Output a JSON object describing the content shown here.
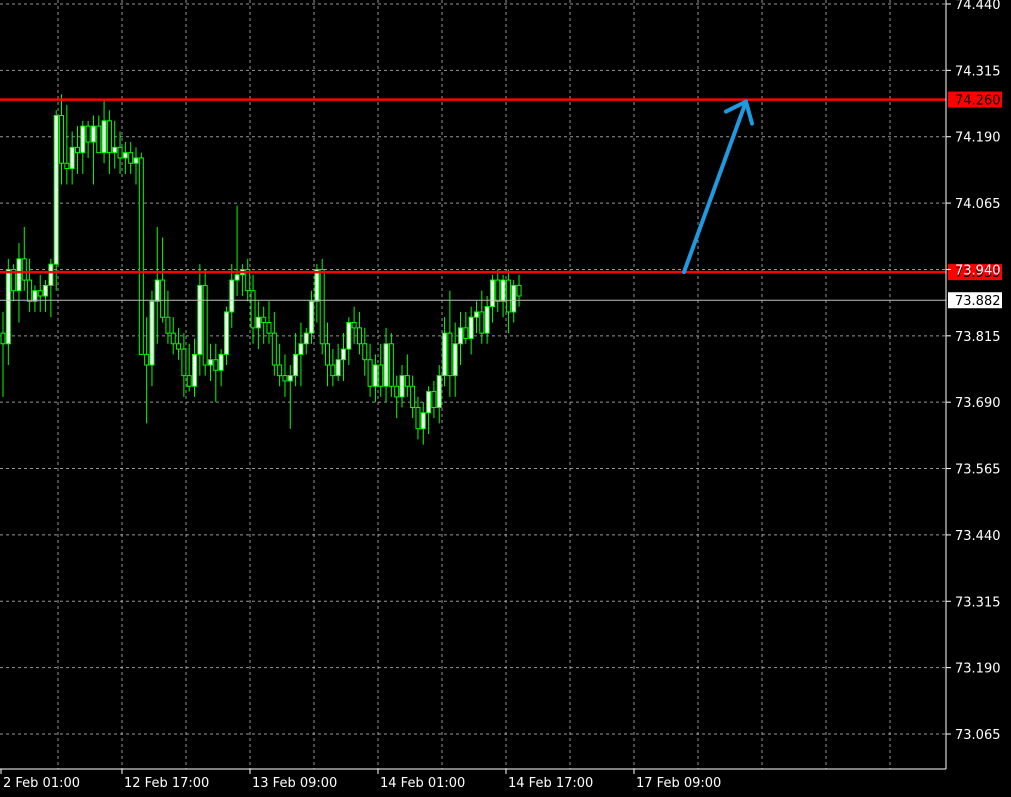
{
  "colors": {
    "background": "#000000",
    "grid": "#c8c8c8",
    "axis": "#ffffff",
    "candle_up_body": "#ffffff",
    "candle_down_body": "#000000",
    "candle_outline": "#00ff00",
    "level_line": "#ff0000",
    "current_price_line": "#c0c0c0",
    "arrow": "#1e9be0"
  },
  "chart_data": {
    "type": "candlestick",
    "ylim": [
      73.0,
      74.44
    ],
    "y_ticks": [
      "74.440",
      "74.315",
      "74.190",
      "74.065",
      "73.940",
      "73.815",
      "73.690",
      "73.565",
      "73.440",
      "73.315",
      "73.190",
      "73.065"
    ],
    "x_ticks": [
      "2 Feb 01:00",
      "12 Feb 17:00",
      "13 Feb 09:00",
      "14 Feb 01:00",
      "14 Feb 17:00",
      "17 Feb 09:00"
    ],
    "grid": true,
    "levels": [
      {
        "value": 74.26,
        "label": "74.260"
      },
      {
        "value": 73.935,
        "label": "73.935"
      }
    ],
    "current_price": {
      "value": 73.882,
      "label": "73.882"
    },
    "candles": [
      [
        73.82,
        73.86,
        73.7,
        73.8
      ],
      [
        73.8,
        73.96,
        73.76,
        73.94
      ],
      [
        73.94,
        73.95,
        73.88,
        73.9
      ],
      [
        73.9,
        73.99,
        73.84,
        73.96
      ],
      [
        73.96,
        74.02,
        73.9,
        73.92
      ],
      [
        73.92,
        73.96,
        73.86,
        73.88
      ],
      [
        73.88,
        73.91,
        73.86,
        73.9
      ],
      [
        73.9,
        73.93,
        73.86,
        73.89
      ],
      [
        73.89,
        73.92,
        73.86,
        73.91
      ],
      [
        73.91,
        73.96,
        73.85,
        73.95
      ],
      [
        73.95,
        74.24,
        73.9,
        74.23
      ],
      [
        74.23,
        74.27,
        74.1,
        74.14
      ],
      [
        74.14,
        74.25,
        74.1,
        74.13
      ],
      [
        74.13,
        74.2,
        74.1,
        74.17
      ],
      [
        74.17,
        74.21,
        74.12,
        74.16
      ],
      [
        74.16,
        74.22,
        74.12,
        74.21
      ],
      [
        74.21,
        74.22,
        74.15,
        74.18
      ],
      [
        74.18,
        74.23,
        74.1,
        74.21
      ],
      [
        74.21,
        74.23,
        74.17,
        74.16
      ],
      [
        74.16,
        74.26,
        74.14,
        74.22
      ],
      [
        74.22,
        74.24,
        74.12,
        74.16
      ],
      [
        74.16,
        74.22,
        74.13,
        74.17
      ],
      [
        74.17,
        74.2,
        74.12,
        74.15
      ],
      [
        74.15,
        74.18,
        74.12,
        74.16
      ],
      [
        74.16,
        74.18,
        74.12,
        74.14
      ],
      [
        74.14,
        74.17,
        74.1,
        74.15
      ],
      [
        74.15,
        74.16,
        73.8,
        73.78
      ],
      [
        73.78,
        73.85,
        73.65,
        73.76
      ],
      [
        73.76,
        73.9,
        73.72,
        73.88
      ],
      [
        73.88,
        74.02,
        73.8,
        73.92
      ],
      [
        73.92,
        74.0,
        73.84,
        73.85
      ],
      [
        73.85,
        73.9,
        73.8,
        73.82
      ],
      [
        73.82,
        73.85,
        73.78,
        73.8
      ],
      [
        73.8,
        73.83,
        73.77,
        73.79
      ],
      [
        73.79,
        73.82,
        73.7,
        73.74
      ],
      [
        73.74,
        73.8,
        73.71,
        73.72
      ],
      [
        73.72,
        73.81,
        73.7,
        73.78
      ],
      [
        73.78,
        73.95,
        73.74,
        73.91
      ],
      [
        73.91,
        73.94,
        73.74,
        73.76
      ],
      [
        73.76,
        73.8,
        73.73,
        73.77
      ],
      [
        73.77,
        73.8,
        73.69,
        73.75
      ],
      [
        73.75,
        73.79,
        73.72,
        73.78
      ],
      [
        73.78,
        73.87,
        73.76,
        73.86
      ],
      [
        73.86,
        73.95,
        73.83,
        73.92
      ],
      [
        73.92,
        74.06,
        73.89,
        73.93
      ],
      [
        73.93,
        73.95,
        73.89,
        73.94
      ],
      [
        73.94,
        73.96,
        73.88,
        73.9
      ],
      [
        73.9,
        73.93,
        73.8,
        73.83
      ],
      [
        73.83,
        73.88,
        73.79,
        73.85
      ],
      [
        73.85,
        73.87,
        73.8,
        73.84
      ],
      [
        73.84,
        73.88,
        73.8,
        73.82
      ],
      [
        73.82,
        73.86,
        73.74,
        73.76
      ],
      [
        73.76,
        73.8,
        73.72,
        73.74
      ],
      [
        73.74,
        73.78,
        73.7,
        73.73
      ],
      [
        73.73,
        73.76,
        73.64,
        73.74
      ],
      [
        73.74,
        73.82,
        73.72,
        73.78
      ],
      [
        73.78,
        73.84,
        73.72,
        73.8
      ],
      [
        73.8,
        73.83,
        73.78,
        73.82
      ],
      [
        73.82,
        73.9,
        73.8,
        73.88
      ],
      [
        73.88,
        73.95,
        73.84,
        73.94
      ],
      [
        73.94,
        73.96,
        73.78,
        73.8
      ],
      [
        73.8,
        73.84,
        73.72,
        73.76
      ],
      [
        73.76,
        73.79,
        73.72,
        73.74
      ],
      [
        73.74,
        73.8,
        73.73,
        73.77
      ],
      [
        73.77,
        73.82,
        73.73,
        73.79
      ],
      [
        73.79,
        73.85,
        73.76,
        73.84
      ],
      [
        73.84,
        73.87,
        73.8,
        73.83
      ],
      [
        73.83,
        73.86,
        73.78,
        73.8
      ],
      [
        73.8,
        73.83,
        73.74,
        73.77
      ],
      [
        73.77,
        73.8,
        73.7,
        73.72
      ],
      [
        73.72,
        73.78,
        73.69,
        73.76
      ],
      [
        73.76,
        73.8,
        73.7,
        73.72
      ],
      [
        73.72,
        73.83,
        73.69,
        73.8
      ],
      [
        73.8,
        73.82,
        73.7,
        73.72
      ],
      [
        73.72,
        73.74,
        73.66,
        73.7
      ],
      [
        73.7,
        73.76,
        73.68,
        73.74
      ],
      [
        73.74,
        73.78,
        73.7,
        73.72
      ],
      [
        73.72,
        73.74,
        73.66,
        73.68
      ],
      [
        73.68,
        73.7,
        73.62,
        73.64
      ],
      [
        73.64,
        73.69,
        73.61,
        73.67
      ],
      [
        73.67,
        73.72,
        73.63,
        73.71
      ],
      [
        73.71,
        73.73,
        73.66,
        73.68
      ],
      [
        73.68,
        73.76,
        73.65,
        73.74
      ],
      [
        73.74,
        73.85,
        73.72,
        73.82
      ],
      [
        73.82,
        73.9,
        73.7,
        73.74
      ],
      [
        73.74,
        73.84,
        73.7,
        73.8
      ],
      [
        73.8,
        73.86,
        73.76,
        73.83
      ],
      [
        73.83,
        73.86,
        73.8,
        73.81
      ],
      [
        73.81,
        73.87,
        73.78,
        73.85
      ],
      [
        73.85,
        73.88,
        73.82,
        73.86
      ],
      [
        73.86,
        73.9,
        73.8,
        73.82
      ],
      [
        73.82,
        73.89,
        73.8,
        73.87
      ],
      [
        73.87,
        73.93,
        73.84,
        73.92
      ],
      [
        73.92,
        73.94,
        73.86,
        73.88
      ],
      [
        73.88,
        73.93,
        73.85,
        73.92
      ],
      [
        73.92,
        73.94,
        73.82,
        73.86
      ],
      [
        73.86,
        73.92,
        73.84,
        73.91
      ],
      [
        73.91,
        73.93,
        73.87,
        73.89
      ]
    ]
  }
}
